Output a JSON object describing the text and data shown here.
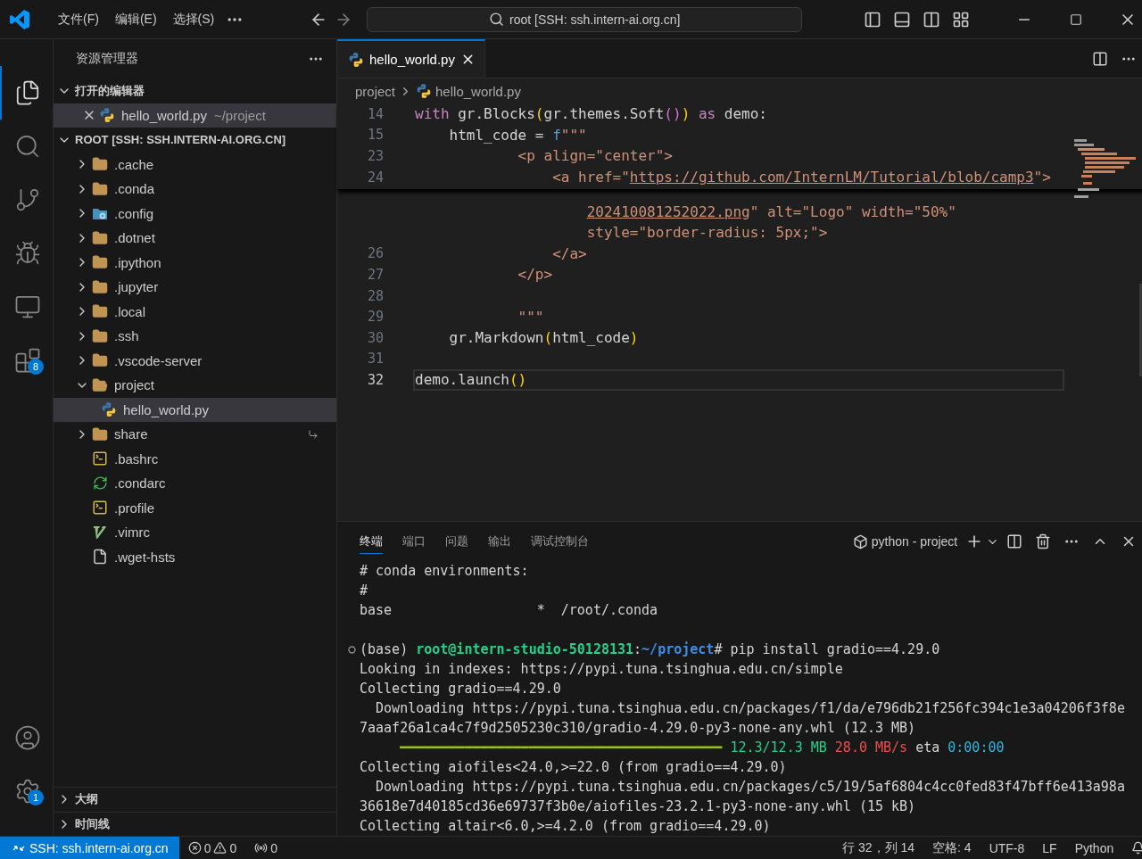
{
  "title_bar": {
    "menus": [
      "文件(F)",
      "编辑(E)",
      "选择(S)"
    ],
    "search": "root [SSH: ssh.intern-ai.org.cn]"
  },
  "activity_bar": {
    "items": [
      {
        "kind": "explorer",
        "selected": true
      },
      {
        "kind": "search",
        "selected": false
      },
      {
        "kind": "source-control",
        "selected": false
      },
      {
        "kind": "run-debug",
        "selected": false
      },
      {
        "kind": "remote",
        "selected": false
      },
      {
        "kind": "extensions",
        "selected": false,
        "badge": "8"
      }
    ],
    "bottom": [
      {
        "kind": "accounts"
      },
      {
        "kind": "manage",
        "badge": "1"
      }
    ]
  },
  "explorer": {
    "title": "资源管理器",
    "open_editors": {
      "label": "打开的编辑器",
      "expanded": true,
      "items": [
        {
          "name": "hello_world.py",
          "path": "~/project",
          "kind": "python",
          "selected": true
        }
      ]
    },
    "root": {
      "label": "ROOT [SSH: SSH.INTERN-AI.ORG.CN]",
      "expanded": true,
      "items": [
        {
          "name": ".cache",
          "kind": "folder",
          "expanded": false,
          "selected": false
        },
        {
          "name": ".conda",
          "kind": "folder",
          "expanded": false,
          "selected": false
        },
        {
          "name": ".config",
          "kind": "config-folder",
          "expanded": false,
          "selected": false
        },
        {
          "name": ".dotnet",
          "kind": "folder",
          "expanded": false,
          "selected": false
        },
        {
          "name": ".ipython",
          "kind": "folder",
          "expanded": false,
          "selected": false
        },
        {
          "name": ".jupyter",
          "kind": "folder",
          "expanded": false,
          "selected": false
        },
        {
          "name": ".local",
          "kind": "folder",
          "expanded": false,
          "selected": false
        },
        {
          "name": ".ssh",
          "kind": "folder",
          "expanded": false,
          "selected": false
        },
        {
          "name": ".vscode-server",
          "kind": "folder",
          "expanded": false,
          "selected": false
        },
        {
          "name": "project",
          "kind": "folder",
          "expanded": true,
          "selected": false,
          "children": [
            {
              "name": "hello_world.py",
              "kind": "python",
              "selected": true
            }
          ]
        },
        {
          "name": "share",
          "kind": "linked-folder",
          "expanded": false,
          "selected": false
        },
        {
          "name": ".bashrc",
          "kind": "shell",
          "selected": false
        },
        {
          "name": ".condarc",
          "kind": "conda",
          "selected": false
        },
        {
          "name": ".profile",
          "kind": "shell",
          "selected": false
        },
        {
          "name": ".vimrc",
          "kind": "vim",
          "selected": false
        },
        {
          "name": ".wget-hsts",
          "kind": "text",
          "selected": false
        }
      ]
    },
    "outline": {
      "label": "大纲",
      "expanded": false
    },
    "timeline": {
      "label": "时间线",
      "expanded": false
    }
  },
  "editor": {
    "tabs": [
      {
        "name": "hello_world.py",
        "kind": "python",
        "selected": true
      }
    ],
    "breadcrumb": [
      {
        "label": "project",
        "kind": "folder"
      },
      {
        "label": "hello_world.py",
        "kind": "python"
      }
    ],
    "sticky_lines": [
      {
        "number": "14",
        "tokens": [
          {
            "t": "with",
            "kind": "keyword"
          },
          {
            "t": " gr.Blocks",
            "kind": "plain"
          },
          {
            "t": "(",
            "kind": "b1"
          },
          {
            "t": "gr.themes.Soft",
            "kind": "plain"
          },
          {
            "t": "()",
            "kind": "b2"
          },
          {
            "t": ")",
            "kind": "b1"
          },
          {
            "t": " as",
            "kind": "keyword"
          },
          {
            "t": " demo:",
            "kind": "plain"
          }
        ]
      },
      {
        "number": "15",
        "tokens": [
          {
            "t": "    html_code = ",
            "kind": "plain"
          },
          {
            "t": "f",
            "kind": "prefix"
          },
          {
            "t": "\"\"\"",
            "kind": "string"
          }
        ]
      },
      {
        "number": "23",
        "tokens": [
          {
            "t": "            <p align=\"center\">",
            "kind": "string"
          }
        ]
      },
      {
        "number": "24",
        "tokens": [
          {
            "t": "                <a href=\"",
            "kind": "string"
          },
          {
            "t": "https://github.com/InternLM/Tutorial/blob/camp3",
            "kind": "link"
          },
          {
            "t": "\">",
            "kind": "string"
          }
        ]
      }
    ],
    "lines": [
      {
        "current": false,
        "tokens": [
          {
            "t": "202410081252022.png",
            "kind": "link"
          },
          {
            "t": "\" alt=\"Logo\" width=\"50%\"",
            "kind": "string"
          }
        ]
      },
      {
        "current": false,
        "tokens": [
          {
            "t": "style=\"border-radius: 5px;\">",
            "kind": "string"
          }
        ]
      },
      {
        "number": "26",
        "current": false,
        "tokens": [
          {
            "t": "                </a>",
            "kind": "string"
          }
        ]
      },
      {
        "number": "27",
        "current": false,
        "tokens": [
          {
            "t": "            </p>",
            "kind": "string"
          }
        ]
      },
      {
        "number": "28",
        "current": false
      },
      {
        "number": "29",
        "current": false,
        "tokens": [
          {
            "t": "            \"\"\"",
            "kind": "string"
          }
        ]
      },
      {
        "number": "30",
        "current": false,
        "tokens": [
          {
            "t": "    gr.Markdown",
            "kind": "plain"
          },
          {
            "t": "(",
            "kind": "b1"
          },
          {
            "t": "html_code",
            "kind": "plain"
          },
          {
            "t": ")",
            "kind": "b1"
          }
        ]
      },
      {
        "number": "31",
        "current": false
      },
      {
        "number": "32",
        "current": true,
        "tokens": [
          {
            "t": "demo.launch",
            "kind": "plain"
          },
          {
            "t": "()",
            "kind": "b1"
          }
        ]
      }
    ]
  },
  "panel": {
    "tabs": [
      {
        "label": "终端",
        "selected": true
      },
      {
        "label": "端口",
        "selected": false
      },
      {
        "label": "问题",
        "selected": false
      },
      {
        "label": "输出",
        "selected": false
      },
      {
        "label": "调试控制台",
        "selected": false
      }
    ],
    "terminal_name": "python - project",
    "lines": [
      {
        "kind": "output",
        "segments": [
          {
            "t": "# conda environments:",
            "kind": "plain"
          }
        ]
      },
      {
        "kind": "output",
        "segments": [
          {
            "t": "#",
            "kind": "plain"
          }
        ]
      },
      {
        "kind": "output",
        "segments": [
          {
            "t": "base                  *  /root/.conda",
            "kind": "plain"
          }
        ]
      },
      {
        "kind": "blank"
      },
      {
        "kind": "command",
        "segments": [
          {
            "t": "(base) ",
            "kind": "plain"
          },
          {
            "t": "root@intern-studio-50128131",
            "kind": "user"
          },
          {
            "t": ":",
            "kind": "plain"
          },
          {
            "t": "~/project",
            "kind": "path"
          },
          {
            "t": "# pip install gradio==4.29.0",
            "kind": "plain"
          }
        ]
      },
      {
        "kind": "output",
        "segments": [
          {
            "t": "Looking in indexes: https://pypi.tuna.tsinghua.edu.cn/simple",
            "kind": "plain"
          }
        ]
      },
      {
        "kind": "output",
        "segments": [
          {
            "t": "Collecting gradio==4.29.0",
            "kind": "plain"
          }
        ]
      },
      {
        "kind": "output",
        "segments": [
          {
            "t": "  Downloading https://pypi.tuna.tsinghua.edu.cn/packages/f1/da/e796db21f256fc394c1e3a04206f3f8e",
            "kind": "plain"
          }
        ]
      },
      {
        "kind": "output",
        "segments": [
          {
            "t": "7aaaf26a1ca4c7f9d2505230c310/gradio-4.29.0-py3-none-any.whl (12.3 MB)",
            "kind": "plain"
          }
        ]
      },
      {
        "kind": "output",
        "segments": [
          {
            "t": "     ━━━━━━━━━━━━━━━━━━━━━━━━━━━━━━━━━━━━━━━━ ",
            "kind": "bar"
          },
          {
            "t": "12.3/12.3 MB",
            "kind": "green"
          },
          {
            "t": " 28.0 MB/s",
            "kind": "red"
          },
          {
            "t": " eta ",
            "kind": "plain"
          },
          {
            "t": "0:00:00",
            "kind": "cyan"
          }
        ]
      },
      {
        "kind": "output",
        "segments": [
          {
            "t": "Collecting aiofiles<24.0,>=22.0 (from gradio==4.29.0)",
            "kind": "plain"
          }
        ]
      },
      {
        "kind": "output",
        "segments": [
          {
            "t": "  Downloading https://pypi.tuna.tsinghua.edu.cn/packages/c5/19/5af6804c4cc0fed83f47bff6e413a98a",
            "kind": "plain"
          }
        ]
      },
      {
        "kind": "output",
        "segments": [
          {
            "t": "36618e7d40185cd36e69737f3b0e/aiofiles-23.2.1-py3-none-any.whl (15 kB)",
            "kind": "plain"
          }
        ]
      },
      {
        "kind": "output",
        "segments": [
          {
            "t": "Collecting altair<6.0,>=4.2.0 (from gradio==4.29.0)",
            "kind": "plain"
          }
        ]
      }
    ]
  },
  "status_bar": {
    "remote": "SSH: ssh.intern-ai.org.cn",
    "errors": "0",
    "warnings": "0",
    "ports": "0",
    "items": [
      "行 32，列 14",
      "空格: 4",
      "UTF-8",
      "LF",
      "Python"
    ]
  }
}
